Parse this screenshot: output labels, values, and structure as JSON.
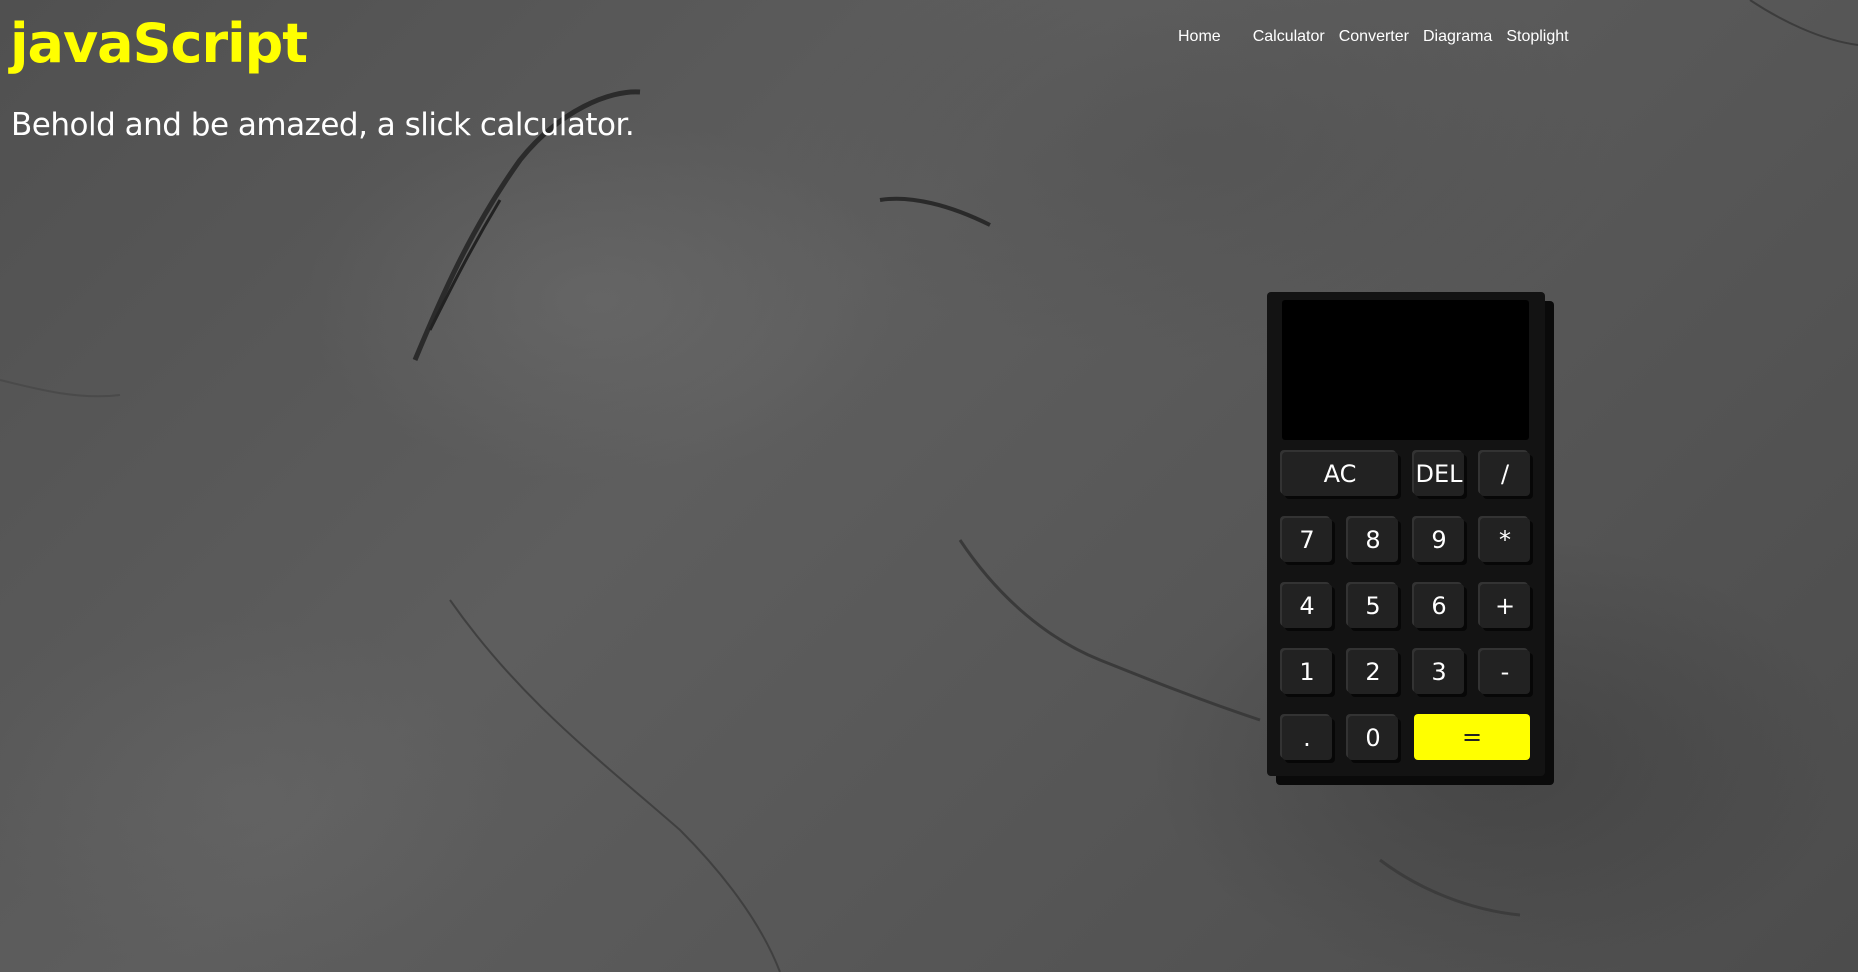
{
  "header": {
    "title": "javaScript",
    "tagline": "Behold and be amazed, a slick calculator."
  },
  "nav": {
    "items": [
      "Home",
      "Calculator",
      "Converter",
      "Diagrama",
      "Stoplight"
    ]
  },
  "calculator": {
    "display_value": "",
    "keys": {
      "ac": "AC",
      "del": "DEL",
      "divide": "/",
      "seven": "7",
      "eight": "8",
      "nine": "9",
      "multiply": "*",
      "four": "4",
      "five": "5",
      "six": "6",
      "plus": "+",
      "one": "1",
      "two": "2",
      "three": "3",
      "minus": "-",
      "decimal": ".",
      "zero": "0",
      "equals": "="
    }
  },
  "colors": {
    "accent": "#ffff00",
    "calculator_body": "#131313",
    "key_background": "#222222",
    "display_background": "#000000"
  }
}
